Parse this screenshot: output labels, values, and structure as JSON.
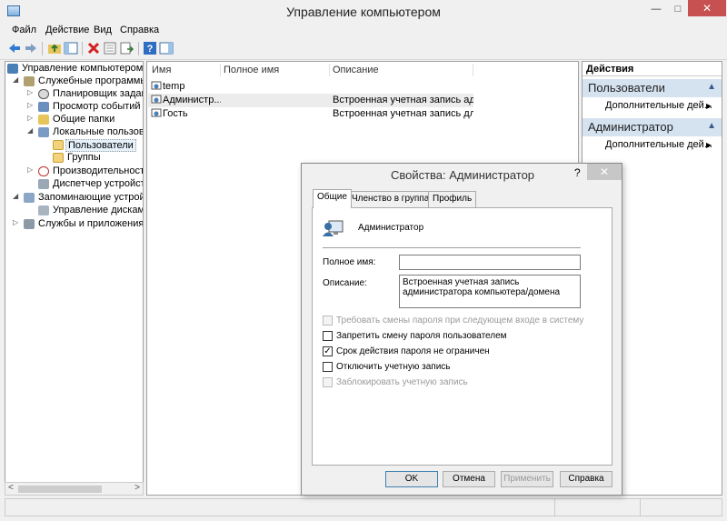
{
  "window": {
    "title": "Управление компьютером"
  },
  "menu": [
    "Файл",
    "Действие",
    "Вид",
    "Справка"
  ],
  "tree": {
    "items": [
      {
        "label": "Управление компьютером (л",
        "icon": "computer-icon"
      },
      {
        "label": "Служебные программы",
        "icon": "tools-icon"
      },
      {
        "label": "Планировщик заданий",
        "icon": "clock-icon"
      },
      {
        "label": "Просмотр событий",
        "icon": "event-viewer-icon"
      },
      {
        "label": "Общие папки",
        "icon": "shared-folder-icon"
      },
      {
        "label": "Локальные пользовате",
        "icon": "users-icon"
      },
      {
        "label": "Пользователи",
        "icon": "folder-icon"
      },
      {
        "label": "Группы",
        "icon": "folder-icon"
      },
      {
        "label": "Производительность",
        "icon": "performance-icon"
      },
      {
        "label": "Диспетчер устройств",
        "icon": "device-manager-icon"
      },
      {
        "label": "Запоминающие устройст",
        "icon": "storage-icon"
      },
      {
        "label": "Управление дисками",
        "icon": "disk-icon"
      },
      {
        "label": "Службы и приложения",
        "icon": "services-icon"
      }
    ]
  },
  "list": {
    "columns": [
      "Имя",
      "Полное имя",
      "Описание"
    ],
    "rows": [
      {
        "name": "temp",
        "fullname": "",
        "description": ""
      },
      {
        "name": "Администр...",
        "fullname": "",
        "description": "Встроенная учетная запись адм..."
      },
      {
        "name": "Гость",
        "fullname": "",
        "description": "Встроенная учетная запись для ..."
      }
    ]
  },
  "actions": {
    "header": "Действия",
    "sections": [
      {
        "title": "Пользователи",
        "item": "Дополнительные дей..."
      },
      {
        "title": "Администратор",
        "item": "Дополнительные дей..."
      }
    ]
  },
  "dialog": {
    "title": "Свойства: Администратор",
    "help": "?",
    "tabs": [
      "Общие",
      "Членство в группах",
      "Профиль"
    ],
    "username": "Администратор",
    "fullname_label": "Полное имя:",
    "fullname_value": "",
    "description_label": "Описание:",
    "description_value": "Встроенная учетная запись администратора компьютера/домена",
    "checkboxes": [
      {
        "label": "Требовать смены пароля при следующем входе в систему",
        "checked": false,
        "disabled": true
      },
      {
        "label": "Запретить смену пароля пользователем",
        "checked": false,
        "disabled": false
      },
      {
        "label": "Срок действия пароля не ограничен",
        "checked": true,
        "disabled": false
      },
      {
        "label": "Отключить учетную запись",
        "checked": false,
        "disabled": false
      },
      {
        "label": "Заблокировать учетную запись",
        "checked": false,
        "disabled": true
      }
    ],
    "buttons": {
      "ok": "OK",
      "cancel": "Отмена",
      "apply": "Применить",
      "help": "Справка"
    }
  },
  "colors": {
    "accent": "#d5e2f0",
    "close_red": "#c75050"
  }
}
